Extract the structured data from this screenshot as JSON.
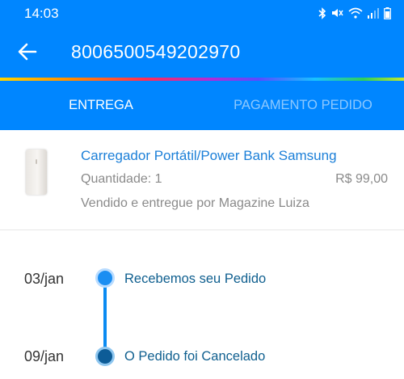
{
  "status_bar": {
    "time": "14:03",
    "icons": [
      "bluetooth-icon",
      "mute-icon",
      "wifi-icon",
      "signal-icon",
      "battery-icon"
    ]
  },
  "toolbar": {
    "back_icon": "arrow-left-icon",
    "title": "8006500549202970"
  },
  "tabs": [
    {
      "label": "ENTREGA",
      "active": true
    },
    {
      "label": "PAGAMENTO PEDIDO",
      "active": false
    }
  ],
  "product": {
    "name": "Carregador Portátil/Power Bank Samsung",
    "quantity": "Quantidade: 1",
    "price": "R$ 99,00",
    "seller": "Vendido e entregue por Magazine Luiza"
  },
  "timeline": [
    {
      "date": "03/jan",
      "label": "Recebemos seu Pedido"
    },
    {
      "date": "09/jan",
      "label": "O Pedido foi Cancelado"
    }
  ],
  "colors": {
    "header": "#0086ff",
    "link": "#1b7fd8",
    "timeline_line": "#0a8bf2",
    "timeline_text": "#0f5f8f"
  }
}
